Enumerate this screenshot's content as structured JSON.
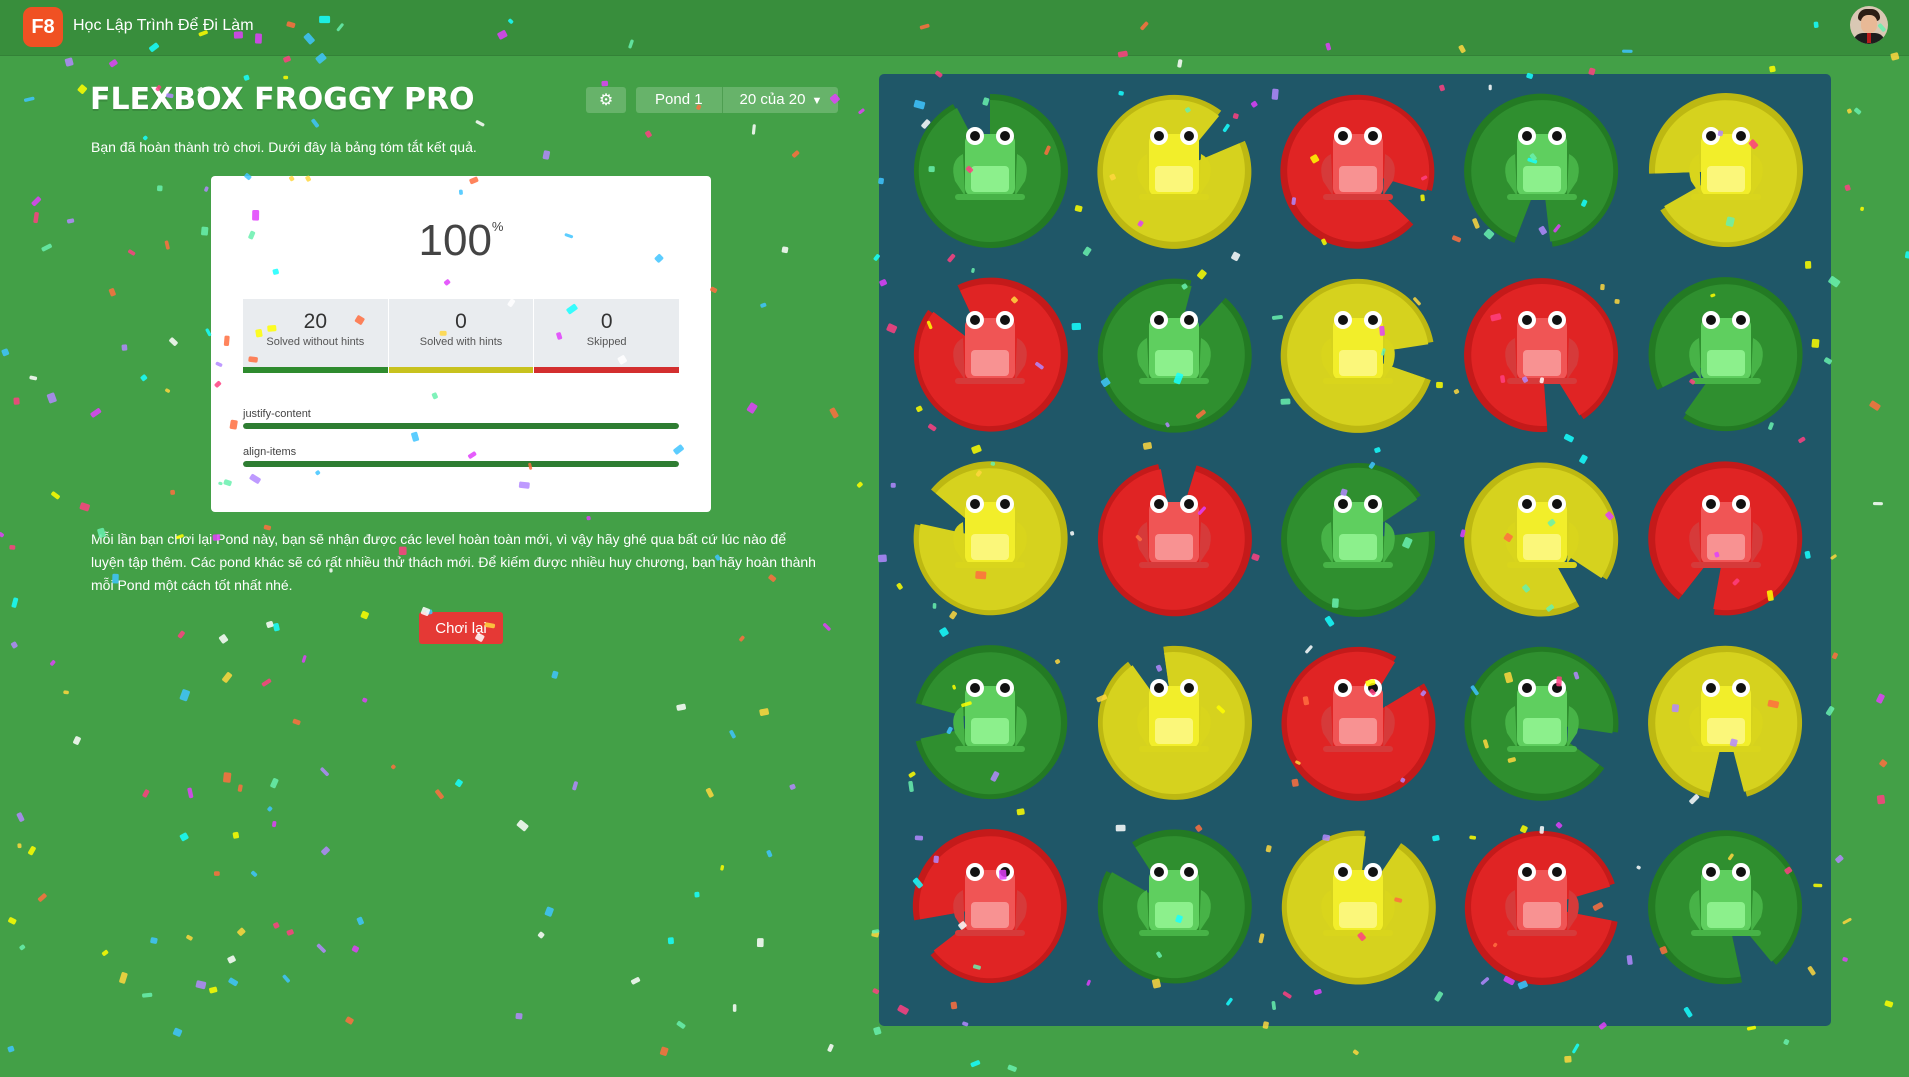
{
  "header": {
    "logo_text": "F8",
    "site_title": "Học Lập Trình Để Đi Làm",
    "avatar_icon": "user-avatar-icon"
  },
  "game": {
    "title": "FLEXBOX FROGGY PRO",
    "settings_icon": "gear-icon",
    "pond_label": "Pond 1",
    "level_label": "20 của 20",
    "level_caret_icon": "caret-down-icon"
  },
  "summary": {
    "intro": "Bạn đã hoàn thành trò chơi. Dưới đây là bảng tóm tắt kết quả.",
    "score_value": "100",
    "score_unit": "%",
    "stats": [
      {
        "value": "20",
        "label": "Solved without hints",
        "color": "#2e8b2e"
      },
      {
        "value": "0",
        "label": "Solved with hints",
        "color": "#c8c21e"
      },
      {
        "value": "0",
        "label": "Skipped",
        "color": "#d32f2f"
      }
    ],
    "topics": [
      {
        "name": "justify-content",
        "progress": 1.0
      },
      {
        "name": "align-items",
        "progress": 1.0
      }
    ],
    "outro": "Mỗi lần bạn chơi lại Pond này, bạn sẽ nhận được các level hoàn toàn mới, vì vậy hãy ghé qua bất cứ lúc nào để luyện tập thêm. Các pond khác sẽ có rất nhiều thử thách mới. Để kiếm được nhiều huy chương, bạn hãy hoàn thành mỗi Pond một cách tốt nhất nhé.",
    "replay_label": "Chơi lại"
  },
  "colors": {
    "background": "#43a047",
    "pond": "#1f5768",
    "green": "#2e8b2e",
    "yellow": "#c8c21e",
    "red": "#d32f2f",
    "replay": "#e53935"
  },
  "pond_grid": [
    [
      "green",
      "yellow",
      "red",
      "green",
      "yellow"
    ],
    [
      "red",
      "green",
      "yellow",
      "red",
      "green"
    ],
    [
      "yellow",
      "red",
      "green",
      "yellow",
      "red"
    ],
    [
      "green",
      "yellow",
      "red",
      "green",
      "yellow"
    ],
    [
      "red",
      "green",
      "yellow",
      "red",
      "green"
    ]
  ]
}
